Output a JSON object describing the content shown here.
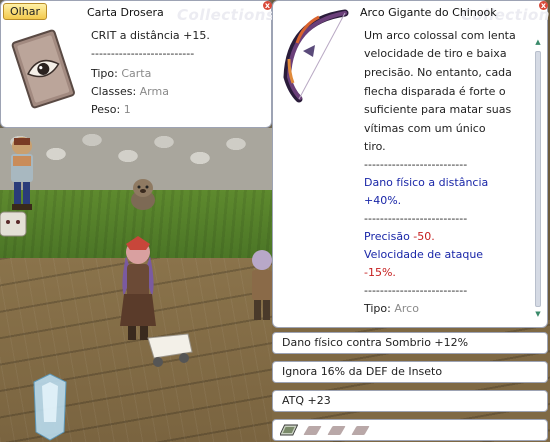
{
  "card_window": {
    "look_button": "Olhar",
    "title": "Carta Drosera",
    "watermark": "Collections",
    "close": "x",
    "lines": {
      "crit": "CRIT a distância +15.",
      "divider": "--------------------------",
      "type_label": "Tipo:",
      "type_value": "Carta",
      "class_label": "Classes:",
      "class_value": "Arma",
      "weight_label": "Peso:",
      "weight_value": "1"
    },
    "icon": "drosera-card-icon"
  },
  "bow_window": {
    "title": "Arco Gigante do Chinook",
    "watermark": "Collections",
    "close": "x",
    "icon": "giant-bow-icon",
    "description": [
      "Um arco colossal com lenta",
      "velocidade de tiro e baixa",
      "precisão. No entanto, cada",
      "flecha disparada é forte o",
      "suficiente para matar suas",
      "vítimas com um único",
      "tiro."
    ],
    "divider": "--------------------------",
    "ranged_damage_l1": "Dano físico a distância",
    "ranged_damage_l2": "+40%.",
    "precision_label": "Precisão ",
    "precision_value": "-50.",
    "attack_speed_label": "Velocidade de ataque",
    "attack_speed_value": "-15%.",
    "type_label": "Tipo:",
    "type_value": "Arco"
  },
  "properties": [
    "Dano físico contra Sombrio +12%",
    "Ignora 16% da DEF de Inseto",
    "ATQ +23"
  ],
  "card_slots": {
    "icon": "card-slot-icon",
    "slots": 4
  },
  "colors": {
    "blue_text": "#1a27a8",
    "red_text": "#c51e1e",
    "muted_text": "#8a8a8a",
    "window_border": "#9da3b4",
    "look_button": "#f3c94c"
  }
}
